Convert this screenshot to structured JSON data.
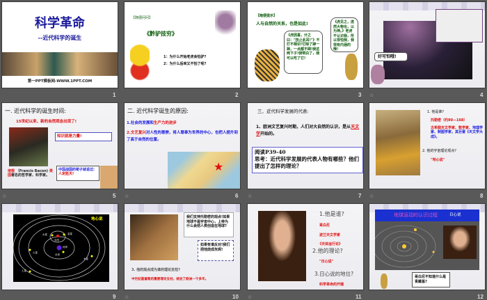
{
  "slides": [
    {
      "num": "1",
      "title": "科学革命",
      "subtitle": "--近代科学的诞生",
      "footer": "第一PPT模板网-WWW.1PPT.COM"
    },
    {
      "num": "2",
      "tag": "【随便问问】",
      "story": "《黔驴技穷》",
      "q1": "1：为什么开始老虎会怕驴?",
      "q2": "2：为什么后来又不怕了呢?"
    },
    {
      "num": "3",
      "tag": "【暗便提示】",
      "line": "人与自然的关系，也是如此!",
      "tiger": "《虎因喜，计之曰：\"技止此耳!\"》不打不相识!它除了蹄一蹄，一点都不碍!我这两下子!我明白了，我可以吃了它!",
      "donkey": "《虎见之，庞然大物也，以为神。》老虎不认识我，所以很怕我，我很有内涵的哦!"
    },
    {
      "num": "4",
      "bubble": "好可怕哦!"
    },
    {
      "num": "5",
      "heading": "一. 近代科学的诞生时间:",
      "line": "15世纪以来，新的自然观念出现了!",
      "quote": "知识就是力量!",
      "name": "培根",
      "name2": "（Francis Bacon)",
      "country": "英国",
      "desc": "著名的哲学家、科学家。",
      "china": "中国战国的荀子就说过:",
      "china2": "人定胜天!"
    },
    {
      "num": "6",
      "heading": "二. 近代科学诞生的原因:",
      "p1a": "1.社会的发展和",
      "p1b": "生产力的进步",
      "p2a": "2.文艺复兴",
      "p2b": "对人性的尊崇，将人尊奉为世界的中心，也把人提升到了高于自然的位置。"
    },
    {
      "num": "7",
      "heading": "三、近代科学发展的代表:",
      "p1": "1、欧洲文艺复兴时期，人们对大自然的认识，是从",
      "p1u": "天文学",
      "p1e": "开始的。",
      "read": "阅读P39-40",
      "think": "思考：近代科学发展的代表人物有哪些？他们提出了怎样的理论？"
    },
    {
      "num": "8",
      "q1": "1. 他是谁?",
      "name": "托勒密（约90—168）",
      "desc1": "古希腊天文学家、数学家、",
      "desc2": "地理学家、制图学家，其巨著《天文学大成》。",
      "q2": "2. 他的宇宙理论观点?",
      "theory": "\"地心说\""
    },
    {
      "num": "9",
      "title": "地心说",
      "labels": [
        "水星",
        "金星",
        "太阳",
        "地球",
        "月球",
        "火星",
        "木星",
        "土星"
      ]
    },
    {
      "num": "10",
      "b1": "我们支持托勒密的观点!如果地球不是宇宙中心，上帝为什么会把人类创造在地球?",
      "b2": "如果有谁反对!我们把他烧成灰烬!",
      "q": "3. 他的观点成为谁的理论支柱?",
      "a": "中世纪基督教的重要理论支柱，统治了欧洲一千多年。"
    },
    {
      "num": "11",
      "q1": "1.他是谁?",
      "n1": "哥白尼",
      "n2": "波兰天文学家",
      "n3": "《天体运行论》",
      "q2": "2.他的理论?",
      "t": "\"日心说\"",
      "q3": "3.日心说的地位?",
      "s": "科学革命的开端"
    },
    {
      "num": "12",
      "banner": "地球运动的认识过程",
      "banner2": "日心说",
      "bubble": "哥白尼不知道什么是青藏基?"
    }
  ],
  "colors": {
    "bg": "#595959",
    "title_blue": "#1c1c9c",
    "red": "#e01010",
    "blue": "#1a1adf"
  }
}
